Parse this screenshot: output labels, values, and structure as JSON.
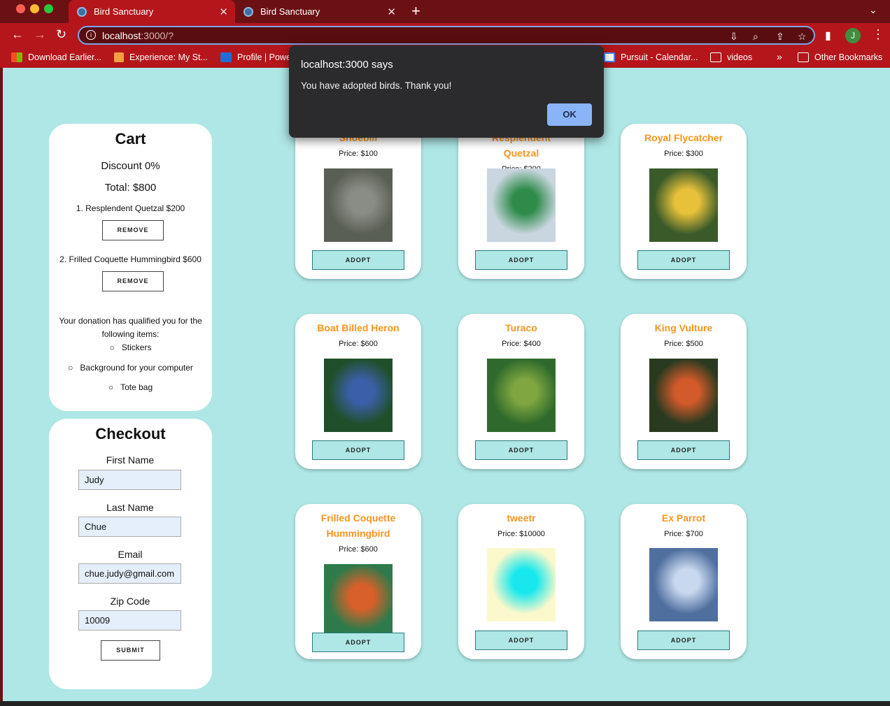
{
  "browser": {
    "tabs": [
      {
        "title": "Bird Sanctuary",
        "active": true
      },
      {
        "title": "Bird Sanctuary",
        "active": false
      }
    ],
    "url_host": "localhost",
    "url_rest": ":3000/?",
    "avatar_letter": "J",
    "bookmarks": [
      "Download Earlier...",
      "Experience: My St...",
      "Profile | Powe",
      "Pursuit - Calendar...",
      "videos",
      "Other Bookmarks"
    ],
    "more_bookmarks": "»"
  },
  "dialog": {
    "title": "localhost:3000 says",
    "message": "You have adopted birds. Thank you!",
    "ok_label": "OK"
  },
  "cart": {
    "heading": "Cart",
    "discount": "Discount 0%",
    "total": "Total: $800",
    "items": [
      {
        "text": "1. Resplendent Quetzal $200",
        "remove_label": "REMOVE"
      },
      {
        "text": "2. Frilled Coquette Hummingbird $600",
        "remove_label": "REMOVE"
      }
    ],
    "bonus_intro": "Your donation has qualified you for the following items:",
    "bonus_items": [
      "Stickers",
      "Background for your computer",
      "Tote bag"
    ]
  },
  "checkout": {
    "heading": "Checkout",
    "fields": [
      {
        "label": "First Name",
        "value": "Judy"
      },
      {
        "label": "Last Name",
        "value": "Chue"
      },
      {
        "label": "Email",
        "value": "chue.judy@gmail.com"
      },
      {
        "label": "Zip Code",
        "value": "10009"
      }
    ],
    "submit_label": "SUBMIT"
  },
  "birds": [
    {
      "name": "Shoebill",
      "price": "Price: $100",
      "adopt_label": "ADOPT",
      "colors": [
        "#5a5f55",
        "#8a8d86"
      ]
    },
    {
      "name": "Resplendent Quetzal",
      "price": "Price: $200",
      "adopt_label": "ADOPT",
      "colors": [
        "#c9d6df",
        "#2e8b4a"
      ]
    },
    {
      "name": "Royal Flycatcher",
      "price": "Price: $300",
      "adopt_label": "ADOPT",
      "colors": [
        "#3a5a2a",
        "#e8c13a"
      ]
    },
    {
      "name": "Boat Billed Heron",
      "price": "Price: $600",
      "adopt_label": "ADOPT",
      "colors": [
        "#1f4f2a",
        "#3b5fa8"
      ]
    },
    {
      "name": "Turaco",
      "price": "Price: $400",
      "adopt_label": "ADOPT",
      "colors": [
        "#2f6a2c",
        "#7fa640"
      ]
    },
    {
      "name": "King Vulture",
      "price": "Price: $500",
      "adopt_label": "ADOPT",
      "colors": [
        "#2a3a20",
        "#d35a2a"
      ]
    },
    {
      "name": "Frilled Coquette Hummingbird",
      "price": "Price: $600",
      "adopt_label": "ADOPT",
      "colors": [
        "#2f7a4a",
        "#d8602a"
      ]
    },
    {
      "name": "tweetr",
      "price": "Price: $10000",
      "adopt_label": "ADOPT",
      "colors": [
        "#fbf8cc",
        "#18e8ee"
      ]
    },
    {
      "name": "Ex Parrot",
      "price": "Price: $700",
      "adopt_label": "ADOPT",
      "colors": [
        "#4f6f9f",
        "#c8d8ef"
      ]
    }
  ]
}
